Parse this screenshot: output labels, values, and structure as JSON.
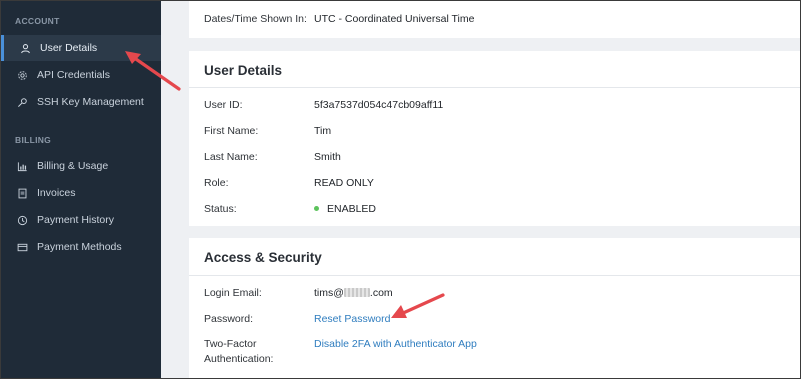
{
  "sidebar": {
    "account_label": "ACCOUNT",
    "billing_label": "BILLING",
    "account_items": [
      {
        "label": "User Details",
        "icon": "user-icon"
      },
      {
        "label": "API Credentials",
        "icon": "gear-icon"
      },
      {
        "label": "SSH Key Management",
        "icon": "key-icon"
      }
    ],
    "billing_items": [
      {
        "label": "Billing & Usage",
        "icon": "bar-chart-icon"
      },
      {
        "label": "Invoices",
        "icon": "document-icon"
      },
      {
        "label": "Payment History",
        "icon": "history-icon"
      },
      {
        "label": "Payment Methods",
        "icon": "credit-card-icon"
      }
    ]
  },
  "settings": {
    "timezone_label": "Dates/Time Shown In:",
    "timezone_value": "UTC - Coordinated Universal Time"
  },
  "user_details": {
    "title": "User Details",
    "rows": [
      {
        "label": "User ID:",
        "value": "5f3a7537d054c47cb09aff11"
      },
      {
        "label": "First Name:",
        "value": "Tim"
      },
      {
        "label": "Last Name:",
        "value": "Smith"
      },
      {
        "label": "Role:",
        "value": "READ ONLY"
      },
      {
        "label": "Status:",
        "value": "ENABLED"
      }
    ]
  },
  "access_security": {
    "title": "Access & Security",
    "login_email_label": "Login Email:",
    "login_email_prefix": "tims@",
    "login_email_suffix": ".com",
    "password_label": "Password:",
    "password_link": "Reset Password",
    "two_factor_label_line1": "Two-Factor",
    "two_factor_label_line2": "Authentication:",
    "two_factor_link": "Disable 2FA with Authenticator App"
  },
  "colors": {
    "sidebar_bg": "#1f2b38",
    "link": "#2f7dbf",
    "status_enabled": "#5cc35c",
    "annotation_arrow": "#e5484d"
  }
}
